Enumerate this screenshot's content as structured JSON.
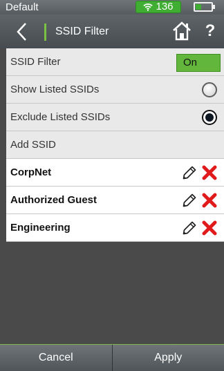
{
  "status_bar": {
    "profile_name": "Default",
    "wifi_count": "136",
    "wifi_icon": "wifi-icon",
    "battery_icon": "battery-icon",
    "battery_level": 0.35
  },
  "header": {
    "back_icon": "chevron-left-icon",
    "title": "SSID Filter",
    "home_icon": "home-icon",
    "help_label": "?"
  },
  "settings": {
    "filter_label": "SSID Filter",
    "filter_value": "On",
    "show_listed_label": "Show Listed SSIDs",
    "show_listed_selected": false,
    "exclude_listed_label": "Exclude Listed SSIDs",
    "exclude_listed_selected": true,
    "add_ssid_label": "Add SSID"
  },
  "ssids": [
    {
      "name": "CorpNet"
    },
    {
      "name": "Authorized Guest"
    },
    {
      "name": "Engineering"
    }
  ],
  "row_icons": {
    "edit": "pencil-icon",
    "delete": "delete-x-icon"
  },
  "footer": {
    "cancel_label": "Cancel",
    "apply_label": "Apply"
  },
  "colors": {
    "accent_green": "#62b63b",
    "delete_red": "#e11b1b",
    "header_gray": "#555b5f"
  }
}
